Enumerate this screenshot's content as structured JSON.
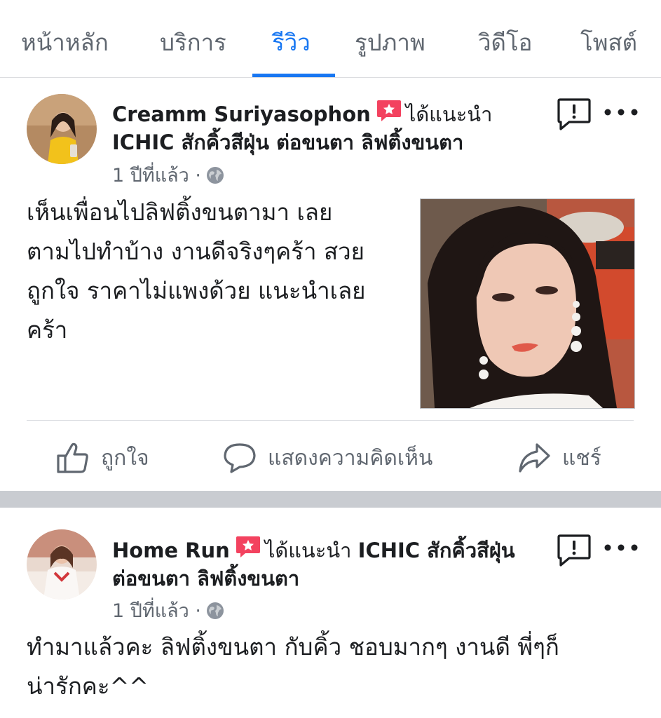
{
  "tabs": [
    {
      "label": "หน้าหลัก"
    },
    {
      "label": "บริการ"
    },
    {
      "label": "รีวิว"
    },
    {
      "label": "รูปภาพ"
    },
    {
      "label": "วิดีโอ"
    },
    {
      "label": "โพสต์"
    }
  ],
  "active_tab": "รีวิว",
  "colors": {
    "accent": "#1877f2",
    "recommend_badge": "#f3425f"
  },
  "posts": [
    {
      "author": "Creamm Suriyasophon",
      "recommends": "ได้แนะนำ",
      "page": "ICHIC สักคิ้วสีฝุ่น ต่อขนตา ลิฟติ้งขนตา",
      "time": "1 ปีที่แล้ว ·",
      "body_lines": [
        "เห็นเพื่อนไปลิฟติ้งขนตามา เลย",
        "ตามไปทำบ้าง งานดีจริงๆคร้า สวย",
        "ถูกใจ ราคาไม่แพงด้วย แนะนำเลย",
        "คร้า"
      ]
    },
    {
      "author": "Home Run",
      "recommends": "ได้แนะนำ",
      "page_line1": "ICHIC สักคิ้วสีฝุ่น",
      "page_line2": "ต่อขนตา ลิฟติ้งขนตา",
      "time": "1 ปีที่แล้ว ·",
      "body_lines": [
        "ทำมาแล้วคะ ลิฟติ้งขนตา กับคิ้ว ชอบมากๆ งานดี พี่ๆก็",
        "น่ารักคะ^^"
      ]
    }
  ],
  "actions": {
    "like": "ถูกใจ",
    "comment": "แสดงความคิดเห็น",
    "share": "แชร์"
  },
  "icons": [
    "recommend-star-icon",
    "globe-icon",
    "report-icon",
    "more-icon",
    "like-icon",
    "comment-icon",
    "share-icon"
  ]
}
